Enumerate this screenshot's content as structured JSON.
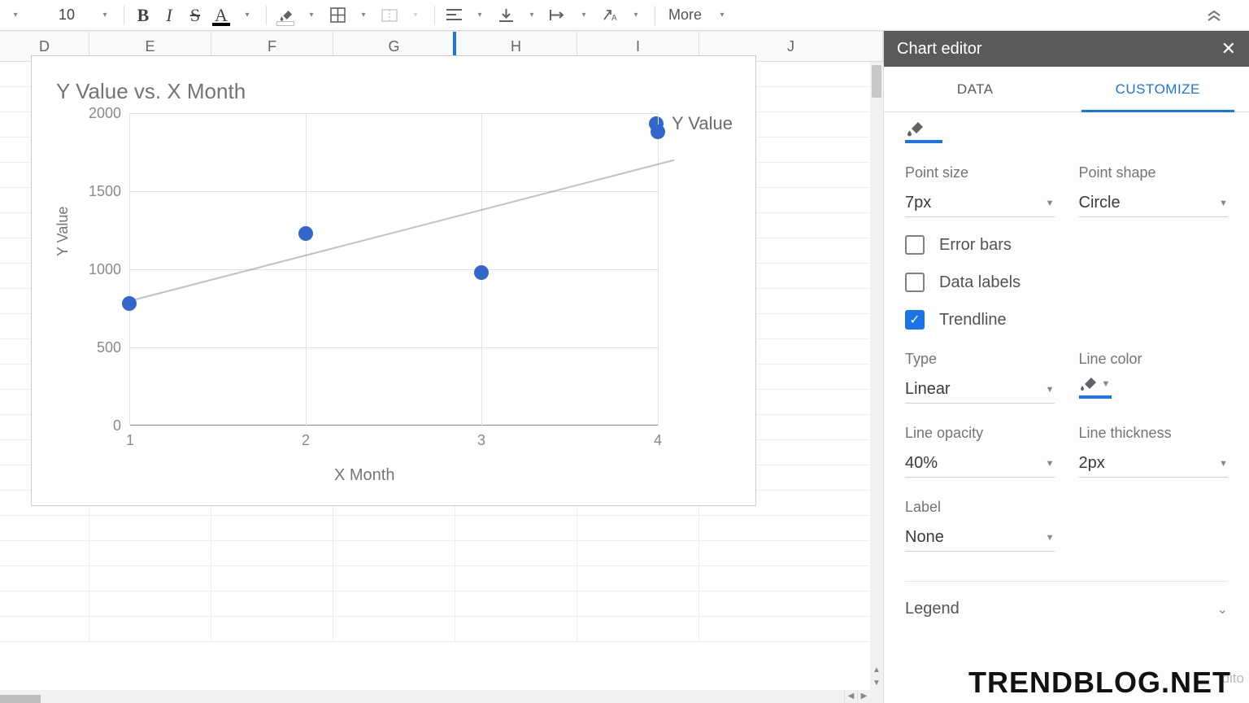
{
  "toolbar": {
    "font_size": "10",
    "bold": "B",
    "italic": "I",
    "strike": "S",
    "textcolor": "A",
    "more": "More"
  },
  "columns": [
    "D",
    "E",
    "F",
    "G",
    "H",
    "I",
    "J"
  ],
  "chart": {
    "title": "Y Value vs. X Month",
    "legend": "Y Value",
    "ylabel": "Y Value",
    "xlabel": "X Month",
    "yticks": [
      "2000",
      "1500",
      "1000",
      "500",
      "0"
    ],
    "xticks": [
      "1",
      "2",
      "3",
      "4"
    ]
  },
  "editor": {
    "title": "Chart editor",
    "tabs": {
      "data": "DATA",
      "customize": "CUSTOMIZE"
    },
    "point_size_label": "Point size",
    "point_size": "7px",
    "point_shape_label": "Point shape",
    "point_shape": "Circle",
    "error_bars": "Error bars",
    "data_labels": "Data labels",
    "trendline": "Trendline",
    "type_label": "Type",
    "type": "Linear",
    "line_color_label": "Line color",
    "line_opacity_label": "Line opacity",
    "line_opacity": "40%",
    "line_thickness_label": "Line thickness",
    "line_thickness": "2px",
    "label_label": "Label",
    "label": "None",
    "legend_section": "Legend"
  },
  "footer_hint": "dito",
  "watermark": "TRENDBLOG.NET",
  "chart_data": {
    "type": "scatter",
    "title": "Y Value vs. X Month",
    "xlabel": "X Month",
    "ylabel": "Y Value",
    "xlim": [
      1,
      4
    ],
    "ylim": [
      0,
      2000
    ],
    "series": [
      {
        "name": "Y Value",
        "points": [
          {
            "x": 1,
            "y": 780
          },
          {
            "x": 2,
            "y": 1230
          },
          {
            "x": 3,
            "y": 980
          },
          {
            "x": 4,
            "y": 1880
          }
        ]
      }
    ],
    "trendline": {
      "type": "Linear",
      "opacity": "40%",
      "thickness": "2px",
      "y1_at_x1": 800,
      "y2_at_x4": 1680
    },
    "legend_position": "right",
    "grid": true
  }
}
